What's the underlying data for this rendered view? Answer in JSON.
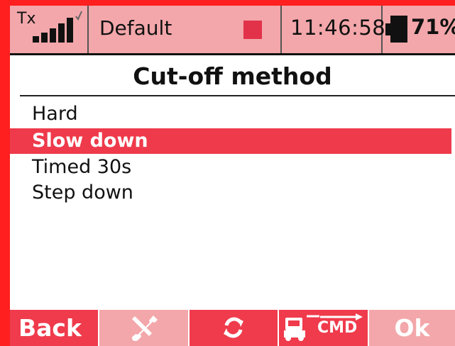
{
  "status_bar": {
    "tx_label": "Tx",
    "signal_icon": "signal-bars-icon",
    "model_name": "Default",
    "time": "11:46:58",
    "battery_percent": "71%",
    "colors": {
      "bar_bg": "#f3a7aa",
      "accent": "#e2324a"
    }
  },
  "title": "Cut-off method",
  "options": [
    {
      "label": "Hard",
      "selected": false
    },
    {
      "label": "Slow down",
      "selected": true
    },
    {
      "label": "Timed 30s",
      "selected": false
    },
    {
      "label": "Step down",
      "selected": false
    }
  ],
  "softkeys": {
    "back_label": "Back",
    "tools_icon": "tools-icon",
    "refresh_icon": "refresh-icon",
    "cmd_icon": "transmitter-cmd-icon",
    "cmd_label": "CMD",
    "ok_label": "Ok"
  }
}
